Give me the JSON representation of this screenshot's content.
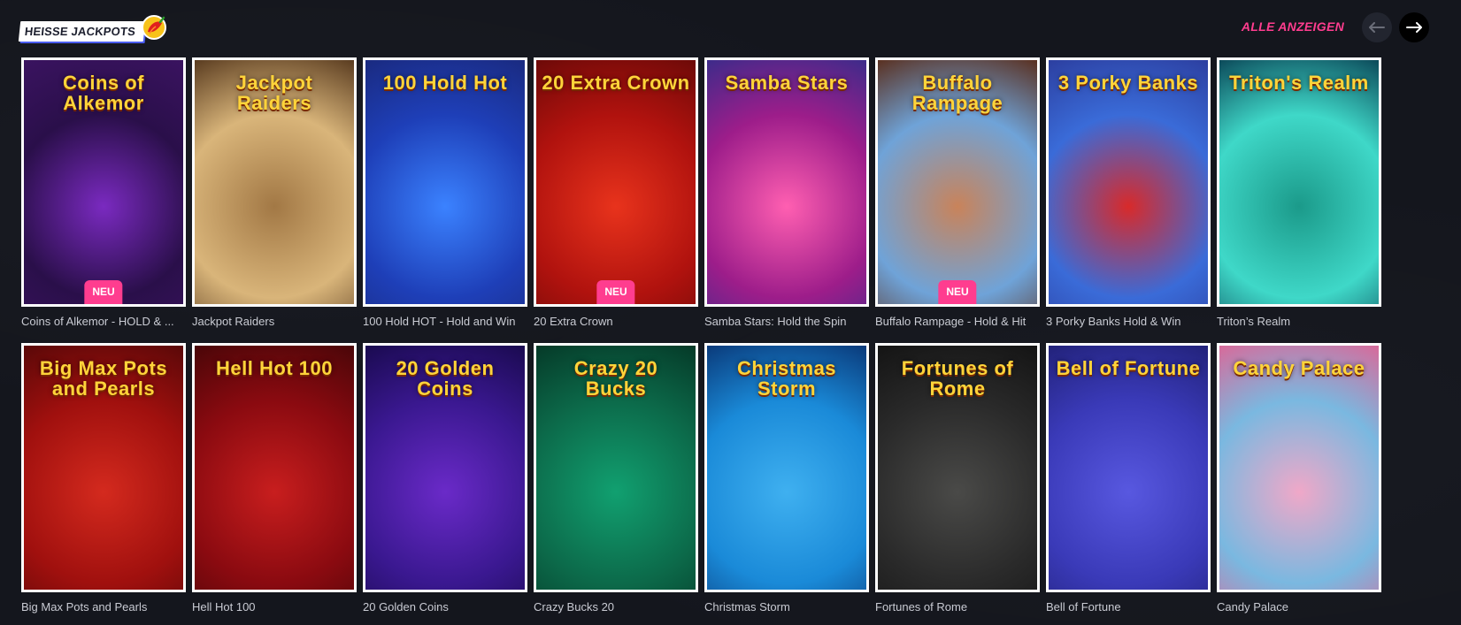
{
  "header": {
    "brand": "HEISSE JACKPOTS",
    "show_all": "ALLE ANZEIGEN",
    "prev_icon": "arrow-left-icon",
    "next_icon": "arrow-right-icon"
  },
  "colors": {
    "accent": "#ff3d8f",
    "background": "#14161d",
    "card_border": "#ffffff"
  },
  "games": {
    "row1": [
      {
        "art": "Coins of Alkemor",
        "label": "Coins of Alkemor - HOLD & ...",
        "badge": "NEU",
        "bg": [
          "#2a0f4a",
          "#7a2ac0",
          "#3a1360"
        ]
      },
      {
        "art": "Jackpot Raiders",
        "label": "Jackpot Raiders",
        "badge": "",
        "bg": [
          "#d9b57a",
          "#a27845",
          "#5a3c20"
        ]
      },
      {
        "art": "100 Hold Hot",
        "label": "100 Hold HOT - Hold and Win",
        "badge": "",
        "bg": [
          "#1e3fb8",
          "#3b82ff",
          "#1a2a80"
        ]
      },
      {
        "art": "20 Extra Crown",
        "label": "20 Extra Crown",
        "badge": "NEU",
        "bg": [
          "#b0120e",
          "#e8331c",
          "#6d0a08"
        ]
      },
      {
        "art": "Samba Stars",
        "label": "Samba Stars: Hold the Spin",
        "badge": "",
        "bg": [
          "#9d1d8a",
          "#ff5fb1",
          "#3d2b8a"
        ]
      },
      {
        "art": "Buffalo Rampage",
        "label": "Buffalo Rampage - Hold & Hit",
        "badge": "NEU",
        "bg": [
          "#6fa3d8",
          "#c9835a",
          "#5a3020"
        ]
      },
      {
        "art": "3 Porky Banks",
        "label": "3 Porky Banks Hold & Win",
        "badge": "",
        "bg": [
          "#3a6bd8",
          "#d82a2a",
          "#2c3fa0"
        ]
      },
      {
        "art": "Triton's Realm",
        "label": "Triton’s Realm",
        "badge": "",
        "bg": [
          "#3fd8c8",
          "#1b9a8a",
          "#0c4a5a"
        ]
      }
    ],
    "row2": [
      {
        "art": "Big Max Pots and Pearls",
        "label": "Big Max Pots and Pearls",
        "badge": "",
        "bg": [
          "#a0100e",
          "#d42a1e",
          "#5a0808"
        ]
      },
      {
        "art": "Hell Hot 100",
        "label": "Hell Hot 100",
        "badge": "",
        "bg": [
          "#8a0a10",
          "#c81e1e",
          "#4a0608"
        ]
      },
      {
        "art": "20 Golden Coins",
        "label": "20 Golden Coins",
        "badge": "",
        "bg": [
          "#3a1890",
          "#6a2ac8",
          "#1a0a50"
        ]
      },
      {
        "art": "Crazy 20 Bucks",
        "label": "Crazy Bucks 20",
        "badge": "",
        "bg": [
          "#0c6a4a",
          "#11a070",
          "#053a28"
        ]
      },
      {
        "art": "Christmas Storm",
        "label": "Christmas Storm",
        "badge": "",
        "bg": [
          "#1a8ad8",
          "#3fb0f0",
          "#0a3a7a"
        ]
      },
      {
        "art": "Fortunes of Rome",
        "label": "Fortunes of Rome",
        "badge": "",
        "bg": [
          "#2a2a2a",
          "#4a4a48",
          "#141414"
        ]
      },
      {
        "art": "Bell of Fortune",
        "label": "Bell of Fortune",
        "badge": "",
        "bg": [
          "#3a3ab8",
          "#5858e0",
          "#22227a"
        ]
      },
      {
        "art": "Candy Palace",
        "label": "Candy Palace",
        "badge": "",
        "bg": [
          "#7ab8e0",
          "#f0a8c8",
          "#d86a9a"
        ]
      }
    ]
  }
}
